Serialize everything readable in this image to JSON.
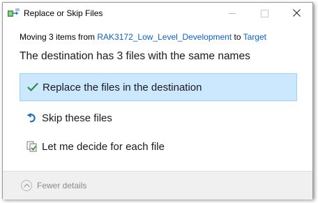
{
  "window": {
    "title": "Replace or Skip Files",
    "icons": {
      "app": "copy-files-icon",
      "minimize": "minimize-icon",
      "maximize": "maximize-icon",
      "close": "close-icon"
    }
  },
  "info": {
    "prefix": "Moving 3 items from ",
    "source": "RAK3172_Low_Level_Development",
    "to": " to ",
    "destination": "Target"
  },
  "headline": "The destination has 3 files with the same names",
  "options": [
    {
      "label": "Replace the files in the destination",
      "icon": "checkmark-icon",
      "selected": true
    },
    {
      "label": "Skip these files",
      "icon": "skip-arrow-icon",
      "selected": false
    },
    {
      "label": "Let me decide for each file",
      "icon": "decide-files-icon",
      "selected": false
    }
  ],
  "footer": {
    "details_label": "Fewer details",
    "icon": "chevron-up-icon"
  },
  "colors": {
    "accent_link": "#0a61c6",
    "selected_bg": "#cce8ff",
    "selected_border": "#99d1ff",
    "check_green": "#2e8b3a",
    "skip_blue": "#1f6fc5"
  }
}
